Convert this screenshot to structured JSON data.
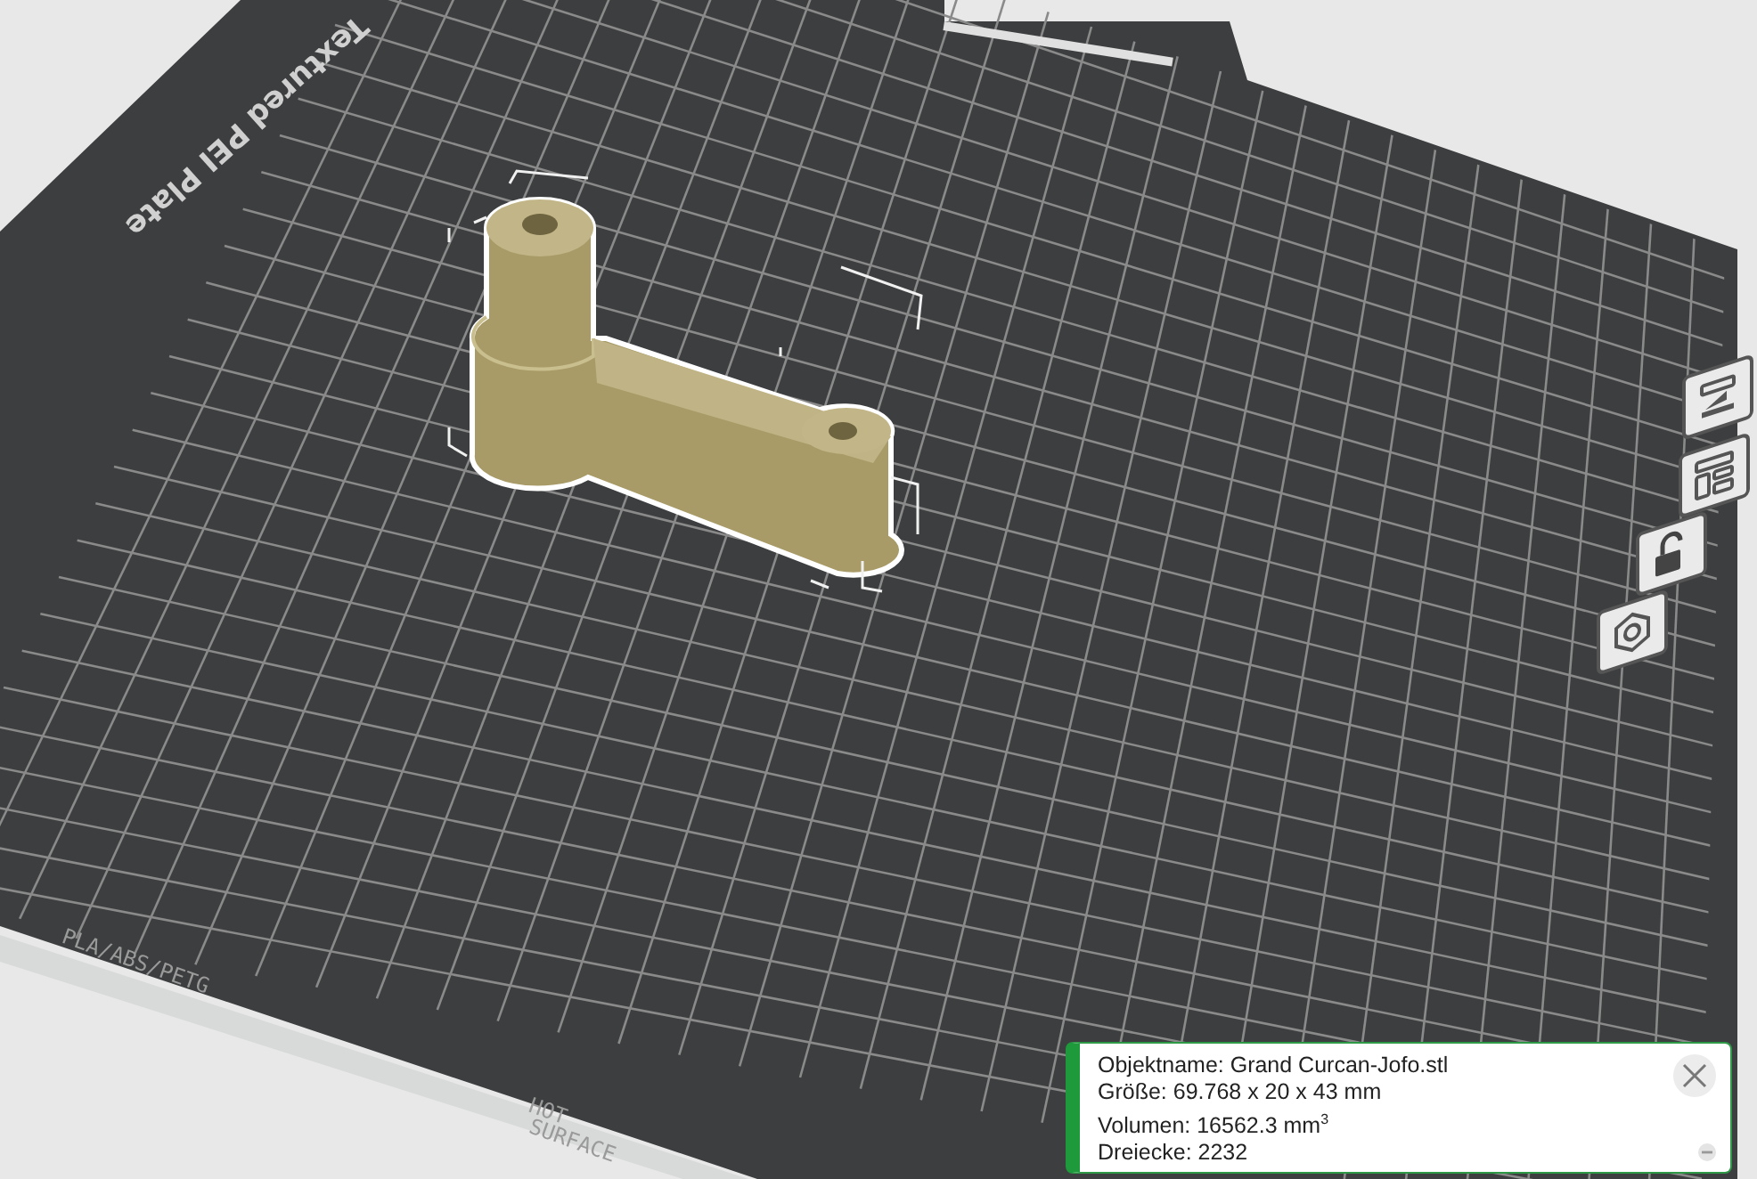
{
  "plate": {
    "name_text": "Textured PEI Plate",
    "material_text": "PLA/ABS/PETG",
    "warning_lines": [
      "HOT",
      "SURFACE"
    ]
  },
  "side_toolbar": [
    {
      "kind": "arrange"
    },
    {
      "kind": "layout"
    },
    {
      "kind": "unlock"
    },
    {
      "kind": "settings"
    }
  ],
  "object_info": {
    "lines": [
      "Objektname: Grand Curcan-Jofo.stl",
      "Größe: 69.768 x 20 x 43 mm",
      "Volumen: 16562.3 mm$^{3}$",
      "Dreiecke: 2232"
    ]
  }
}
